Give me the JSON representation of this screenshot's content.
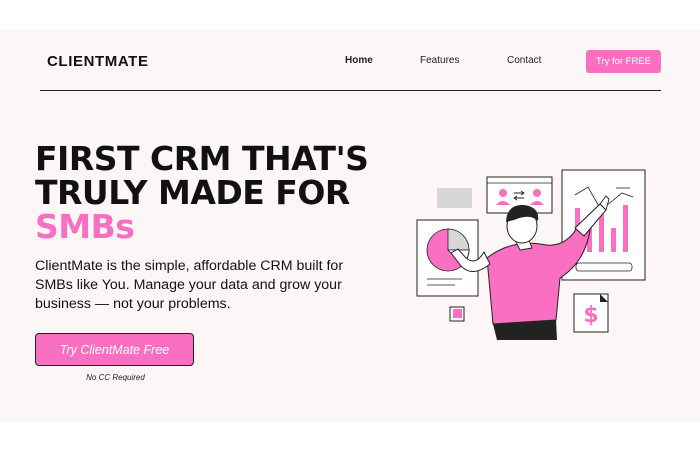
{
  "brand": {
    "name": "CLIENTMATE",
    "accent": "#fa6fc1"
  },
  "nav": {
    "home": "Home",
    "features": "Features",
    "contact": "Contact",
    "cta": "Try for FREE"
  },
  "hero": {
    "title_line1": "FIRST CRM THAT'S",
    "title_line2": "TRULY MADE FOR",
    "title_accent": "SMBs",
    "subtitle": "ClientMate is the simple, affordable CRM built for SMBs like You. Manage your data and grow your business — not your problems.",
    "cta": "Try ClientMate Free",
    "note": "No CC Required"
  },
  "illustration": {
    "currency_symbol": "$"
  }
}
